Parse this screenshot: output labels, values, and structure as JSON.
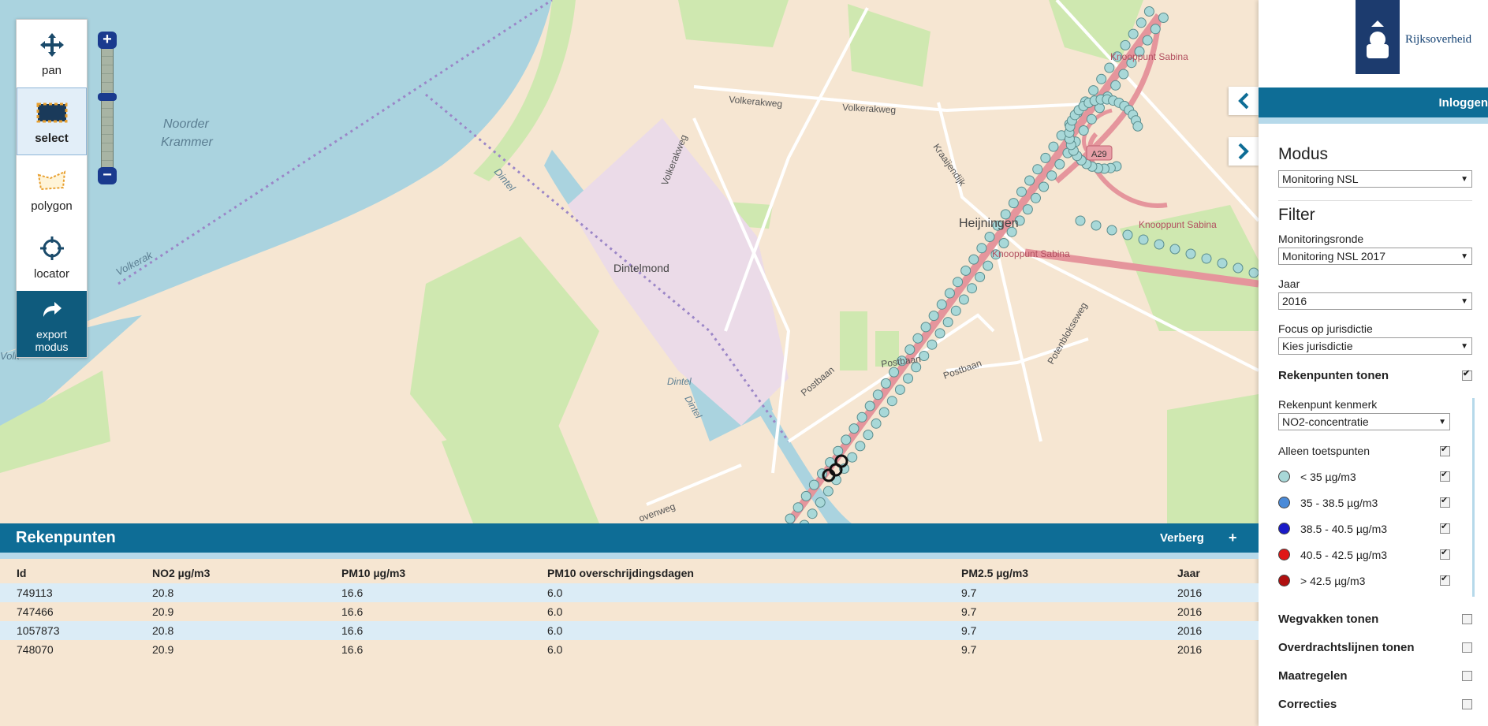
{
  "toolbar": {
    "pan": "pan",
    "select": "select",
    "polygon": "polygon",
    "locator": "locator",
    "export_line1": "export",
    "export_line2": "modus"
  },
  "map_labels": {
    "water": [
      "Noorder",
      "Krammer"
    ],
    "volkerak1": "Volkerak",
    "volkerak2": "Volkerak",
    "volkerakweg1": "Volkerakweg",
    "volkerakweg2": "Volkerakweg",
    "volkerakweg3": "Volkerakweg",
    "dintel": "Dintel",
    "dintel2": "Dintel",
    "dintel3": "Dintel",
    "dintelmond": "Dintelmond",
    "heijningen": "Heijningen",
    "postbaan1": "Postbaan",
    "postbaan2": "Postbaan",
    "postbaan3": "Postbaan",
    "potenblokseweg": "Potenblokseweg",
    "kraaijendijk": "Kraaijendijk",
    "knooppunt1": "Knooppunt Sabina",
    "knooppunt2": "Knooppunt Sabina",
    "knooppunt3": "Knooppunt Sabina",
    "a29": "A29",
    "wenweg": "ovenweg",
    "volk": "Volk"
  },
  "panel": {
    "logo_text": "Rijksoverheid",
    "login": "Inloggen",
    "modus_title": "Modus",
    "modus_value": "Monitoring NSL",
    "filter_title": "Filter",
    "ronde_label": "Monitoringsronde",
    "ronde_value": "Monitoring NSL 2017",
    "jaar_label": "Jaar",
    "jaar_value": "2016",
    "focus_label": "Focus op jurisdictie",
    "focus_value": "Kies jurisdictie",
    "rekenpunten_tonen": "Rekenpunten tonen",
    "kenmerk_label": "Rekenpunt kenmerk",
    "kenmerk_value": "NO2-concentratie",
    "alleen_toets": "Alleen toetspunten",
    "legend": [
      {
        "label": "< 35 µg/m3",
        "color": "#a8d8d8"
      },
      {
        "label": "35 - 38.5 µg/m3",
        "color": "#4a8ad8"
      },
      {
        "label": "38.5 - 40.5 µg/m3",
        "color": "#1a1ac8"
      },
      {
        "label": "40.5 - 42.5 µg/m3",
        "color": "#e01818"
      },
      {
        "label": "> 42.5 µg/m3",
        "color": "#b01010"
      }
    ],
    "wegvakken": "Wegvakken tonen",
    "overdracht": "Overdrachtslijnen tonen",
    "maatregelen": "Maatregelen",
    "correcties": "Correcties"
  },
  "table": {
    "title": "Rekenpunten",
    "hide": "Verberg",
    "add": "+",
    "columns": [
      "Id",
      "NO2 µg/m3",
      "PM10 µg/m3",
      "PM10 overschrijdingsdagen",
      "PM2.5 µg/m3",
      "Jaar"
    ],
    "rows": [
      [
        "749113",
        "20.8",
        "16.6",
        "6.0",
        "9.7",
        "2016"
      ],
      [
        "747466",
        "20.9",
        "16.6",
        "6.0",
        "9.7",
        "2016"
      ],
      [
        "1057873",
        "20.8",
        "16.6",
        "6.0",
        "9.7",
        "2016"
      ],
      [
        "748070",
        "20.9",
        "16.6",
        "6.0",
        "9.7",
        "2016"
      ]
    ]
  },
  "colors": {
    "header_blue": "#0e6d96",
    "light_blue": "#b6d9ea",
    "water": "#aad3df",
    "land": "#f6e6d2",
    "point": "#a8d8d8"
  }
}
